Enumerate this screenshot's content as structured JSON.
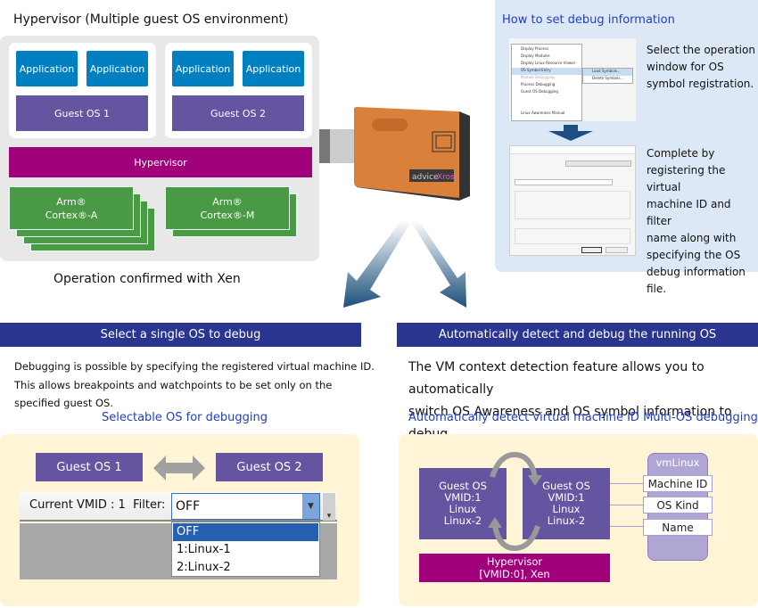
{
  "left_diagram": {
    "title": "Hypervisor (Multiple guest OS environment)",
    "guests": [
      {
        "apps": [
          "Application",
          "Application"
        ],
        "os": "Guest OS 1"
      },
      {
        "apps": [
          "Application",
          "Application"
        ],
        "os": "Guest OS 2"
      }
    ],
    "hypervisor": "Hypervisor",
    "cpus": [
      [
        "Arm®",
        "Cortex®-A"
      ],
      [
        "Arm®",
        "Cortex®-M"
      ]
    ],
    "caption": "Operation confirmed with Xen"
  },
  "device": {
    "logo": "adviceXross"
  },
  "howto": {
    "title": "How to set debug information",
    "menu": {
      "items": [
        "Display Process",
        "Display Modules",
        "Display Linux Resource Viewer",
        "OS Symbol Entry",
        "Module Debugging",
        "Process Debugging",
        "Guest OS Debugging",
        "Linux Awareness Manual"
      ],
      "submenu": [
        "Load Symbols...",
        "Delete Symbols..."
      ]
    },
    "step1": [
      "Select the operation",
      "window for OS",
      "symbol registration."
    ],
    "step2": [
      "Complete by",
      "registering the virtual",
      "machine ID and filter",
      "name along with",
      "specifying the OS",
      "debug information file."
    ]
  },
  "single": {
    "banner": "Select a single OS to debug",
    "desc": [
      "Debugging is possible by specifying the registered virtual machine ID.",
      "This allows breakpoints and watchpoints to be set only on the",
      "specified guest OS."
    ],
    "subtitle": "Selectable OS for debugging",
    "os1": "Guest OS 1",
    "os2": "Guest OS 2",
    "toolbar_label": "Current VMID : 1  Filter:",
    "filter_value": "OFF",
    "options": [
      "OFF",
      "1:Linux-1",
      "2:Linux-2"
    ]
  },
  "auto": {
    "banner": "Automatically detect and debug the running OS",
    "desc": [
      "The VM context detection feature allows you to automatically",
      "switch OS Awareness and OS symbol information to debug."
    ],
    "subtitle": "Automatically detect virtual machine ID Multi-OS debugging",
    "guests": [
      [
        "Guest OS",
        "VMID:1",
        "Linux",
        "Linux-2"
      ],
      [
        "Guest OS",
        "VMID:1",
        "Linux",
        "Linux-2"
      ]
    ],
    "hypervisor": [
      "Hypervisor",
      "[VMID:0], Xen"
    ],
    "vmlinux": "vmLinux",
    "fields": [
      "Machine ID",
      "OS Kind",
      "Name"
    ]
  },
  "colors": {
    "app": "#0080c0",
    "guest_os": "#6554a0",
    "hypervisor": "#a0007a",
    "cpu": "#4a9a45",
    "banner": "#2a3590",
    "accent_text": "#2040c0"
  }
}
